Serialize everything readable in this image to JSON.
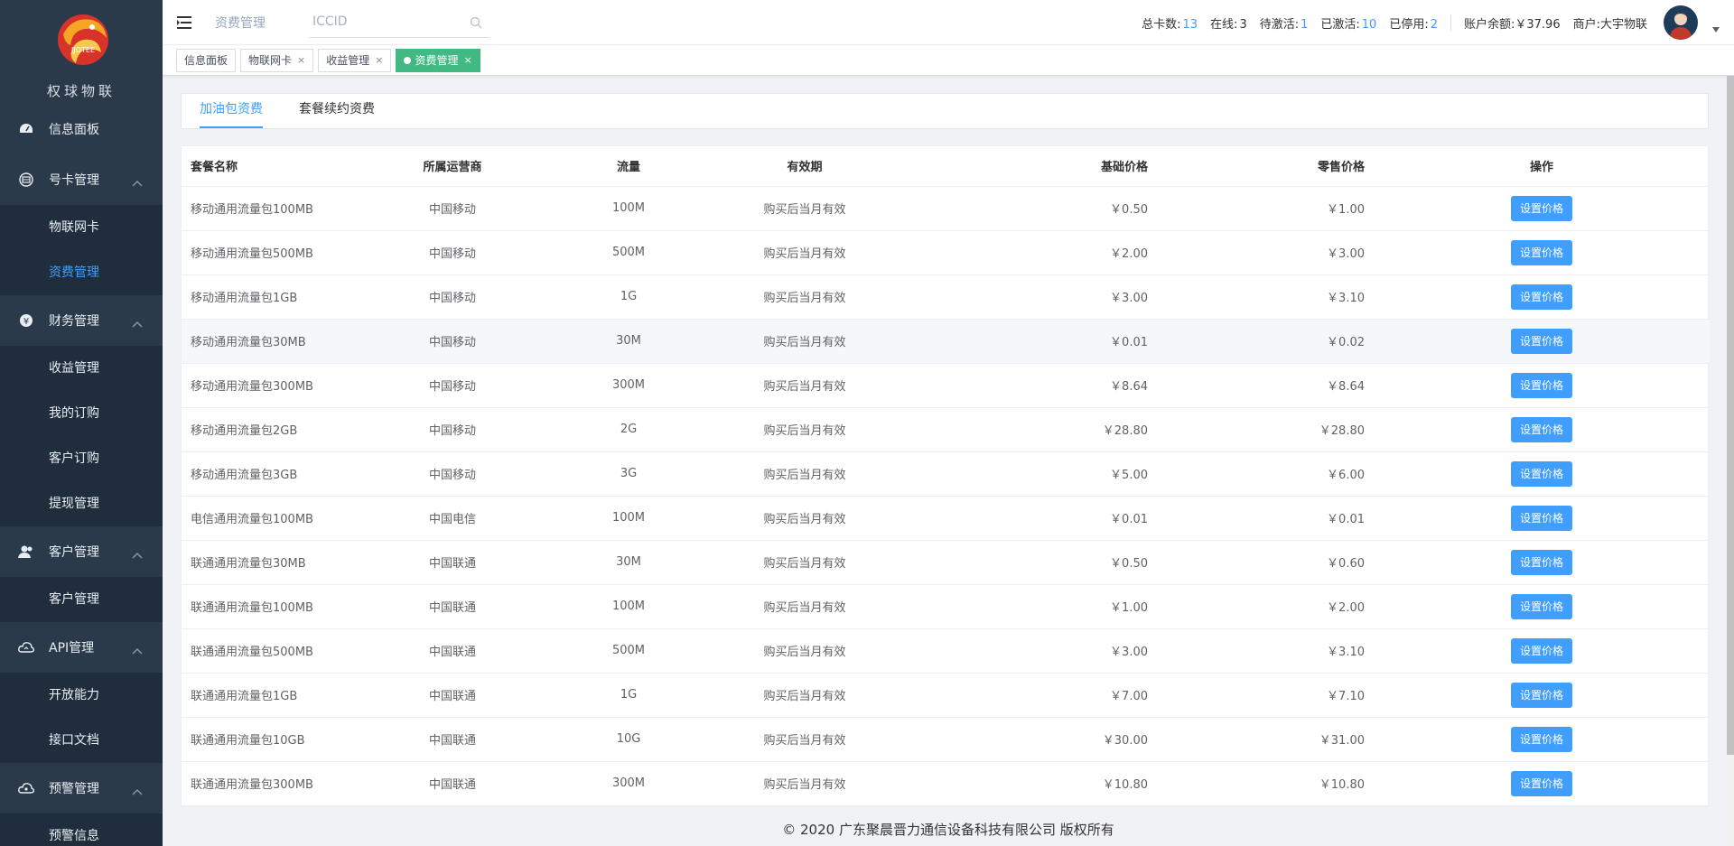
{
  "brand": {
    "name": "权球物联",
    "logo_text": "JJOTEE"
  },
  "sidebar": {
    "items": [
      {
        "label": "信息面板",
        "icon": "dashboard-icon"
      },
      {
        "label": "号卡管理",
        "icon": "card-icon",
        "children": [
          "物联网卡",
          "资费管理"
        ]
      },
      {
        "label": "财务管理",
        "icon": "yen-icon",
        "children": [
          "收益管理",
          "我的订购",
          "客户订购",
          "提现管理"
        ]
      },
      {
        "label": "客户管理",
        "icon": "users-icon",
        "children": [
          "客户管理"
        ]
      },
      {
        "label": "API管理",
        "icon": "cloud-icon",
        "children": [
          "开放能力",
          "接口文档"
        ]
      },
      {
        "label": "预警管理",
        "icon": "cloud-alert-icon",
        "children": [
          "预警信息"
        ]
      }
    ],
    "active": "资费管理"
  },
  "header": {
    "breadcrumb": "资费管理",
    "search_placeholder": "ICCID",
    "stats": [
      {
        "label": "总卡数:",
        "value": "13",
        "highlight": true
      },
      {
        "label": "在线:",
        "value": "3",
        "highlight": false
      },
      {
        "label": "待激活:",
        "value": "1",
        "highlight": true
      },
      {
        "label": "已激活:",
        "value": "10",
        "highlight": true
      },
      {
        "label": "已停用:",
        "value": "2",
        "highlight": true
      }
    ],
    "balance": "账户余额:￥37.96",
    "merchant": "商户:大宇物联"
  },
  "tags": [
    {
      "label": "信息面板",
      "closable": false,
      "active": false
    },
    {
      "label": "物联网卡",
      "closable": true,
      "active": false
    },
    {
      "label": "收益管理",
      "closable": true,
      "active": false
    },
    {
      "label": "资费管理",
      "closable": true,
      "active": true
    }
  ],
  "tabs": [
    {
      "label": "加油包资费",
      "active": true
    },
    {
      "label": "套餐续约资费",
      "active": false
    }
  ],
  "table": {
    "columns": [
      "套餐名称",
      "所属运营商",
      "流量",
      "有效期",
      "基础价格",
      "零售价格",
      "操作"
    ],
    "action_label": "设置价格",
    "rows": [
      [
        "移动通用流量包100MB",
        "中国移动",
        "100M",
        "购买后当月有效",
        "￥0.50",
        "￥1.00"
      ],
      [
        "移动通用流量包500MB",
        "中国移动",
        "500M",
        "购买后当月有效",
        "￥2.00",
        "￥3.00"
      ],
      [
        "移动通用流量包1GB",
        "中国移动",
        "1G",
        "购买后当月有效",
        "￥3.00",
        "￥3.10"
      ],
      [
        "移动通用流量包30MB",
        "中国移动",
        "30M",
        "购买后当月有效",
        "￥0.01",
        "￥0.02"
      ],
      [
        "移动通用流量包300MB",
        "中国移动",
        "300M",
        "购买后当月有效",
        "￥8.64",
        "￥8.64"
      ],
      [
        "移动通用流量包2GB",
        "中国移动",
        "2G",
        "购买后当月有效",
        "￥28.80",
        "￥28.80"
      ],
      [
        "移动通用流量包3GB",
        "中国移动",
        "3G",
        "购买后当月有效",
        "￥5.00",
        "￥6.00"
      ],
      [
        "电信通用流量包100MB",
        "中国电信",
        "100M",
        "购买后当月有效",
        "￥0.01",
        "￥0.01"
      ],
      [
        "联通通用流量包30MB",
        "中国联通",
        "30M",
        "购买后当月有效",
        "￥0.50",
        "￥0.60"
      ],
      [
        "联通通用流量包100MB",
        "中国联通",
        "100M",
        "购买后当月有效",
        "￥1.00",
        "￥2.00"
      ],
      [
        "联通通用流量包500MB",
        "中国联通",
        "500M",
        "购买后当月有效",
        "￥3.00",
        "￥3.10"
      ],
      [
        "联通通用流量包1GB",
        "中国联通",
        "1G",
        "购买后当月有效",
        "￥7.00",
        "￥7.10"
      ],
      [
        "联通通用流量包10GB",
        "中国联通",
        "10G",
        "购买后当月有效",
        "￥30.00",
        "￥31.00"
      ],
      [
        "联通通用流量包300MB",
        "中国联通",
        "300M",
        "购买后当月有效",
        "￥10.80",
        "￥10.80"
      ]
    ]
  },
  "footer": "© 2020 广东聚晨晋力通信设备科技有限公司 版权所有",
  "colors": {
    "sidebar": "#2b3a4b",
    "submenu": "#1f2d3d",
    "accent": "#409eff",
    "tag_active": "#42b983"
  }
}
